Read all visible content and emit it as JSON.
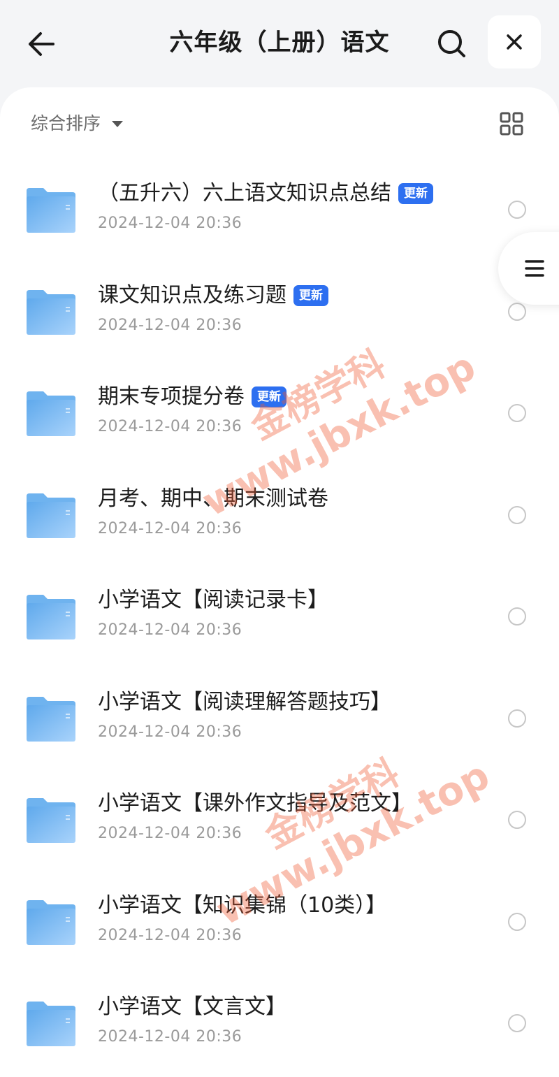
{
  "header": {
    "title": "六年级（上册）语文",
    "back_icon": "arrow-left-icon",
    "search_icon": "search-icon",
    "close_icon": "close-icon"
  },
  "toolbar": {
    "sort_label": "综合排序",
    "sort_icon": "caret-down-icon",
    "view_toggle_icon": "grid-view-icon"
  },
  "side_menu_icon": "menu-icon",
  "badge_color": "#2d6ff0",
  "folder_color": "#6fb3ef",
  "files": [
    {
      "name": "（五升六）六上语文知识点总结",
      "badge": "更新",
      "date": "2024-12-04 20:36"
    },
    {
      "name": "课文知识点及练习题",
      "badge": "更新",
      "date": "2024-12-04 20:36"
    },
    {
      "name": "期末专项提分卷",
      "badge": "更新",
      "date": "2024-12-04 20:36"
    },
    {
      "name": "月考、期中、期末测试卷",
      "badge": "",
      "date": "2024-12-04 20:36"
    },
    {
      "name": "小学语文【阅读记录卡】",
      "badge": "",
      "date": "2024-12-04 20:36"
    },
    {
      "name": "小学语文【阅读理解答题技巧】",
      "badge": "",
      "date": "2024-12-04 20:36"
    },
    {
      "name": "小学语文【课外作文指导及范文】",
      "badge": "",
      "date": "2024-12-04 20:36"
    },
    {
      "name": "小学语文【知识集锦（10类）】",
      "badge": "",
      "date": "2024-12-04 20:36"
    },
    {
      "name": "小学语文【文言文】",
      "badge": "",
      "date": "2024-12-04 20:36"
    }
  ],
  "watermarks": [
    {
      "line1": "金榜学科",
      "line2": "www.jbxk.top"
    },
    {
      "line1": "金榜学科",
      "line2": "www.jbxk.top"
    }
  ]
}
